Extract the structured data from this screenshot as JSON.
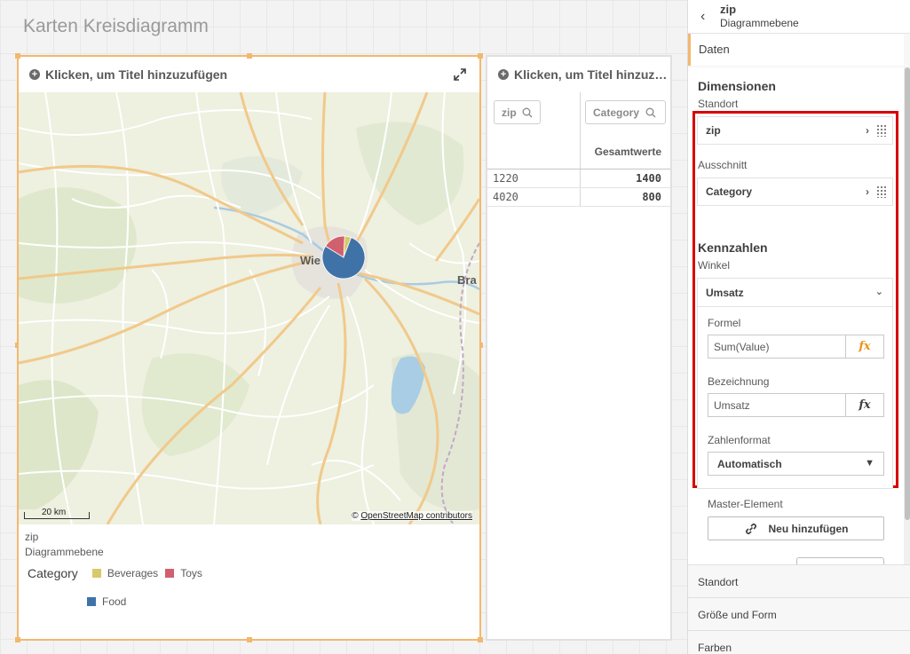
{
  "sheet": {
    "title": "Karten Kreisdiagramm"
  },
  "map_card": {
    "title_placeholder": "Klicken, um Titel hinzuzufügen",
    "place_labels": {
      "vienna": "Wie",
      "bratislava": "Bra"
    },
    "scale_label": "20 km",
    "attribution_prefix": "©",
    "attribution_link": "OpenStreetMap contributors",
    "layer_title": "zip",
    "layer_subtitle": "Diagrammebene",
    "legend": {
      "title": "Category",
      "items": [
        {
          "label": "Beverages",
          "color": "#d8c96a"
        },
        {
          "label": "Toys",
          "color": "#d0606e"
        },
        {
          "label": "Food",
          "color": "#3f73a8"
        }
      ]
    }
  },
  "chart_data": {
    "type": "pie",
    "title": "",
    "categories": [
      "Food",
      "Toys",
      "Beverages"
    ],
    "values": [
      0.78,
      0.17,
      0.05
    ],
    "colors": [
      "#3f73a8",
      "#d0606e",
      "#d8c96a"
    ]
  },
  "table_card": {
    "title_placeholder": "Klicken, um Titel hinzuz…",
    "search_zip": "zip",
    "search_category": "Category",
    "total_header": "Gesamtwerte",
    "rows": [
      {
        "zip": "1220",
        "value": "1400"
      },
      {
        "zip": "4020",
        "value": "800"
      }
    ]
  },
  "panel": {
    "header_title": "zip",
    "header_subtitle": "Diagrammebene",
    "tab_data": "Daten",
    "dimensions": {
      "heading": "Dimensionen",
      "location_label": "Standort",
      "location_field": "zip",
      "slice_label": "Ausschnitt",
      "slice_field": "Category"
    },
    "measures": {
      "heading": "Kennzahlen",
      "angle_label": "Winkel",
      "measure_name": "Umsatz",
      "formula_label": "Formel",
      "formula_value": "Sum(Value)",
      "name_label": "Bezeichnung",
      "name_value": "Umsatz",
      "numformat_label": "Zahlenformat",
      "numformat_value": "Automatisch",
      "fx_label": "fx"
    },
    "master_item": {
      "label": "Master-Element",
      "button": "Neu hinzufügen"
    },
    "sections": [
      "Standort",
      "Größe und Form",
      "Farben"
    ],
    "accent_color": "#f2b86f",
    "highlight_color": "#d70000"
  }
}
